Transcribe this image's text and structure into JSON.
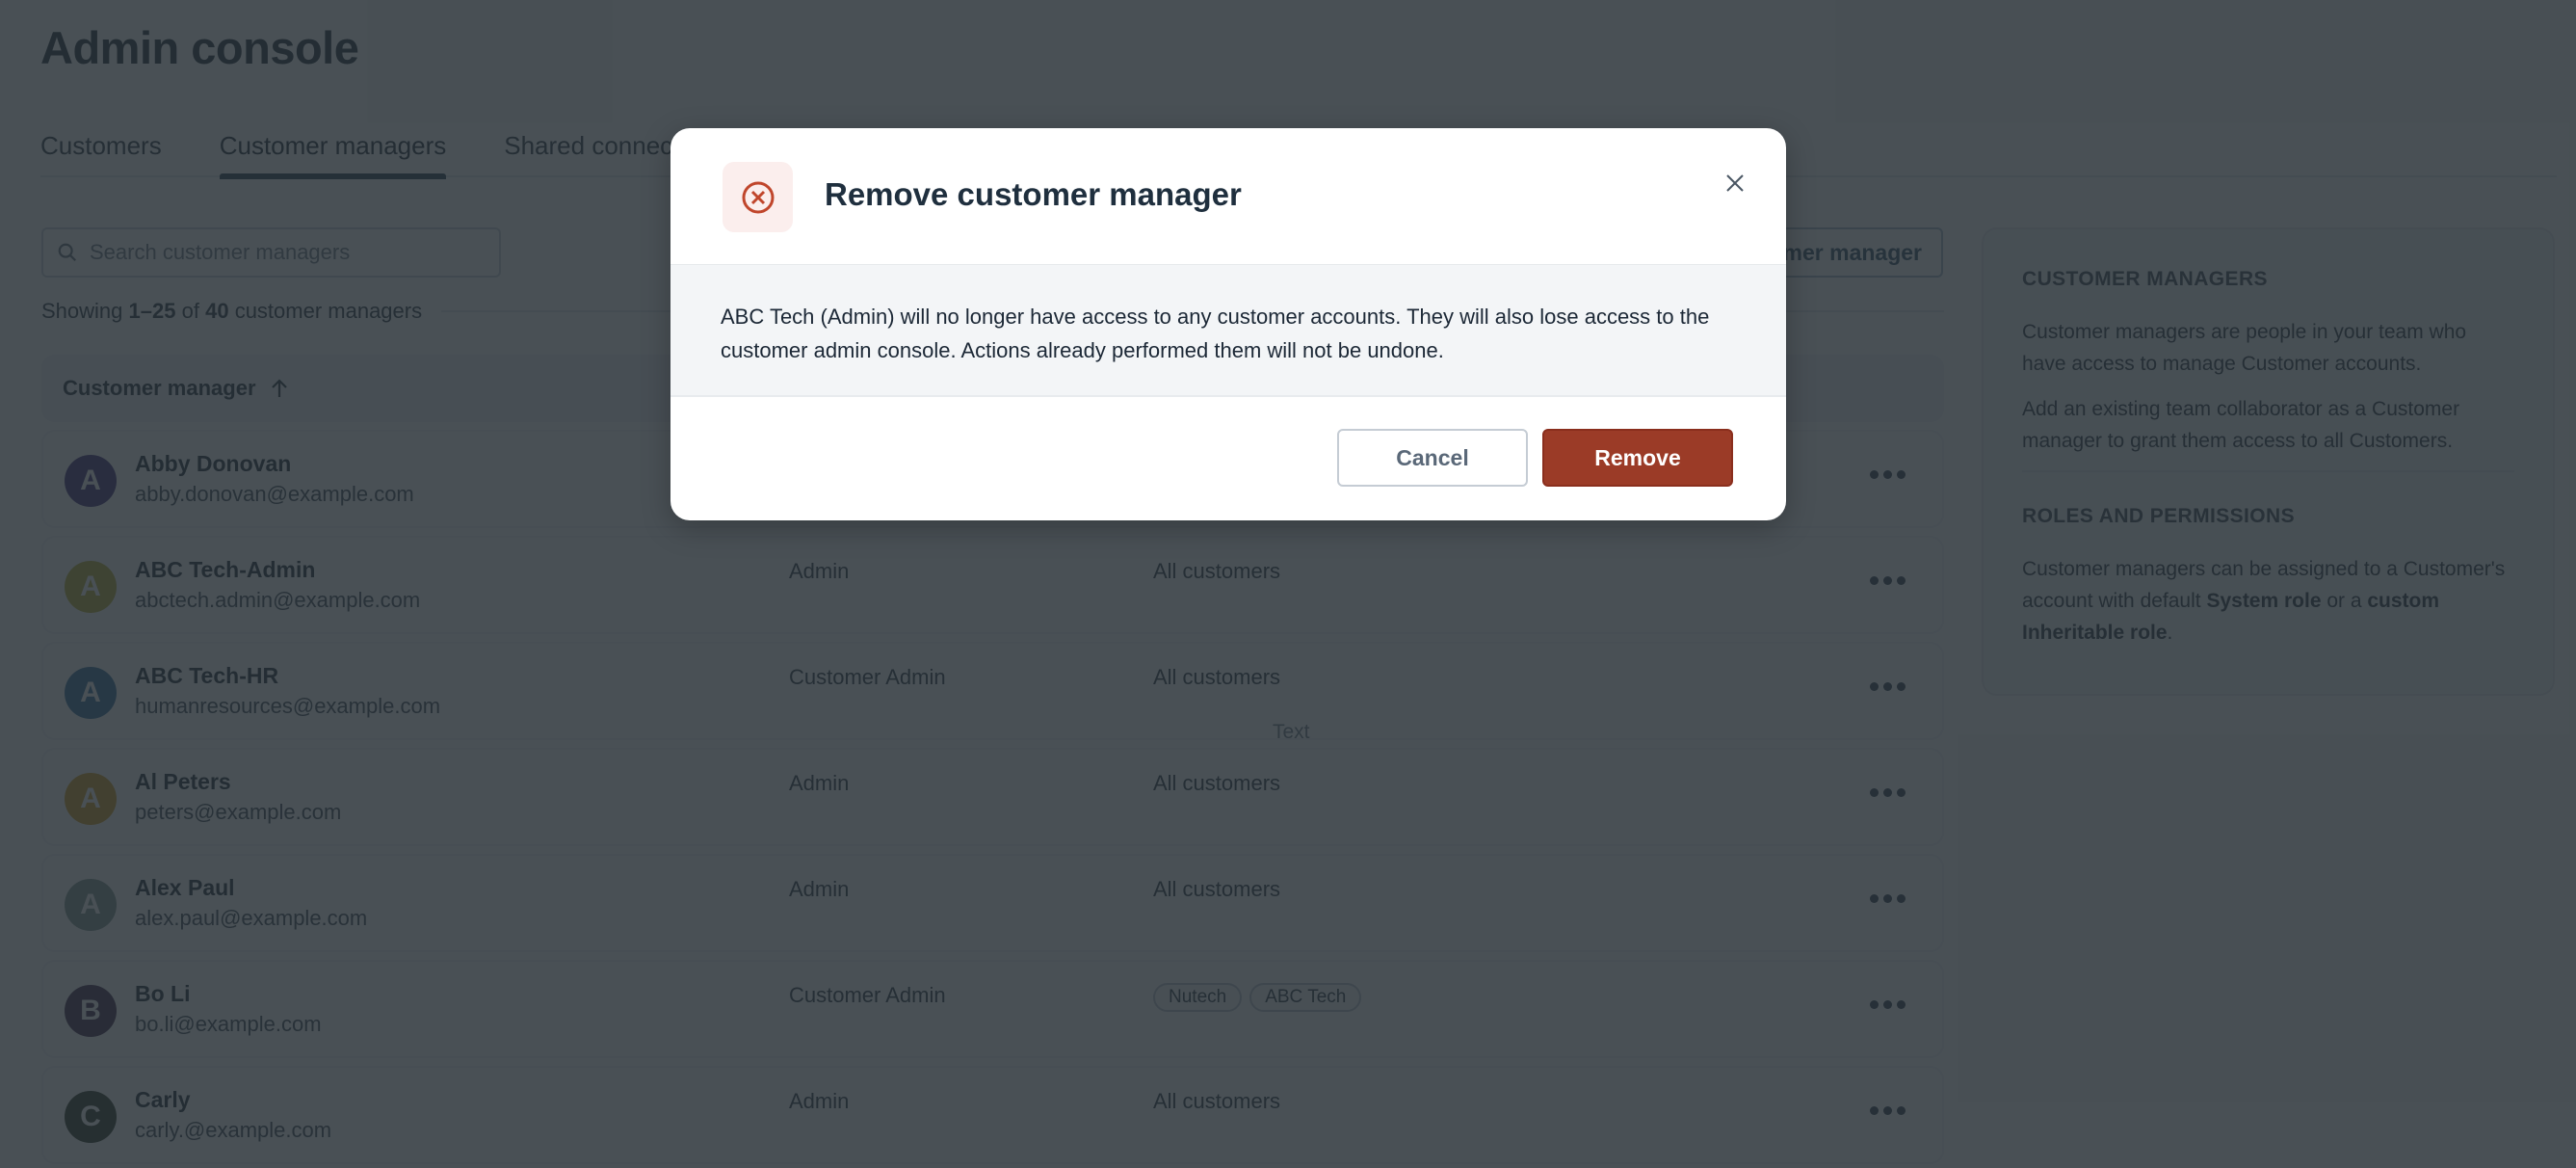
{
  "page": {
    "title": "Admin console",
    "tabs": [
      {
        "label": "Customers",
        "active": false
      },
      {
        "label": "Customer managers",
        "active": true
      },
      {
        "label": "Shared connectors",
        "active": false
      }
    ],
    "search": {
      "placeholder": "Search customer managers",
      "value": ""
    },
    "add_button_label": "Add customer manager",
    "showing": {
      "prefix": "Showing ",
      "range": "1–25",
      "middle": " of ",
      "total": "40",
      "suffix": " customer managers"
    },
    "table": {
      "header": {
        "column": "Customer manager",
        "sort": "ascending",
        "sort_icon": "arrow-up-icon"
      },
      "rows": [
        {
          "initial": "A",
          "avatar_color": "#3a2a78",
          "name": "Abby Donovan",
          "email": "abby.donovan@example.com",
          "role": "",
          "access": "",
          "chips": []
        },
        {
          "initial": "A",
          "avatar_color": "#b8ad2e",
          "name": "ABC Tech-Admin",
          "email": "abctech.admin@example.com",
          "role": "Admin",
          "access": "All customers",
          "chips": []
        },
        {
          "initial": "A",
          "avatar_color": "#2f6d9e",
          "name": "ABC Tech-HR",
          "email": "humanresources@example.com",
          "role": "Customer Admin",
          "access": "All customers",
          "chips": [],
          "ghost_text": "Text"
        },
        {
          "initial": "A",
          "avatar_color": "#d49a1a",
          "name": "Al Peters",
          "email": "peters@example.com",
          "role": "Admin",
          "access": "All customers",
          "chips": []
        },
        {
          "initial": "A",
          "avatar_color": "#7d968f",
          "name": "Alex Paul",
          "email": "alex.paul@example.com",
          "role": "Admin",
          "access": "All customers",
          "chips": []
        },
        {
          "initial": "B",
          "avatar_color": "#3b2345",
          "name": "Bo Li",
          "email": "bo.li@example.com",
          "role": "Customer Admin",
          "access": "",
          "chips": [
            "Nutech",
            "ABC Tech"
          ]
        },
        {
          "initial": "C",
          "avatar_color": "#27321f",
          "name": "Carly",
          "email": "carly.@example.com",
          "role": "Admin",
          "access": "All customers",
          "chips": []
        }
      ],
      "row_menu_icon": "more-horizontal-icon"
    },
    "side_panel": {
      "section1": {
        "heading": "CUSTOMER MANAGERS",
        "p1": "Customer managers are people in your team who have access to manage Customer accounts.",
        "p2": "Add an existing team collaborator as a Customer manager to grant them access to all Customers."
      },
      "section2": {
        "heading": "ROLES AND PERMISSIONS",
        "p_start": "Customer managers can be assigned to a Customer's account with default ",
        "bold1": "System role",
        "p_mid": " or a ",
        "bold2": "custom Inheritable role",
        "p_end": "."
      }
    }
  },
  "modal": {
    "title": "Remove customer manager",
    "icon": "circle-x-icon",
    "body": "ABC Tech (Admin) will no longer have access to any customer accounts. They will also lose access to the customer admin console. Actions already performed them will not be undone.",
    "cancel_label": "Cancel",
    "remove_label": "Remove",
    "colors": {
      "danger": "#9b3b27",
      "icon_bg": "#fbeeed",
      "icon_stroke": "#c0462c"
    }
  }
}
